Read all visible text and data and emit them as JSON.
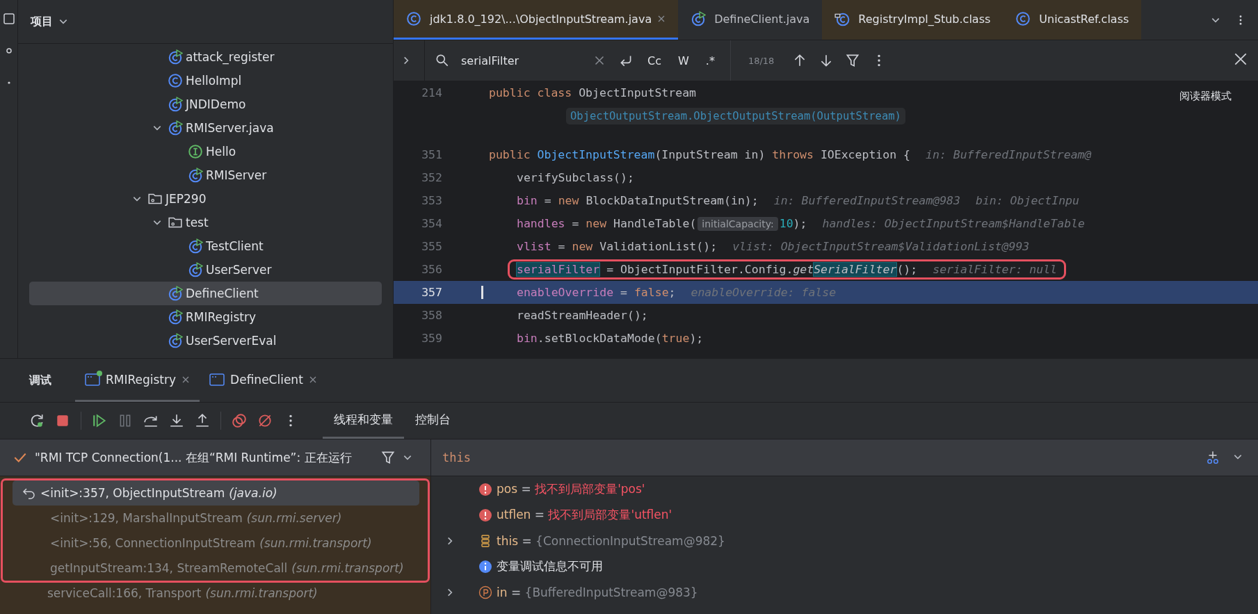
{
  "project": {
    "title": "项目",
    "tree": [
      {
        "children": [
          {
            "label": "attack_register",
            "kind": "class-run",
            "selected": false
          },
          {
            "label": "HelloImpl",
            "kind": "class",
            "selected": false
          },
          {
            "label": "JNDIDemo",
            "kind": "class-run",
            "selected": false
          },
          {
            "label": "RMIServer.java",
            "kind": "class-run",
            "selected": false,
            "expanded": true,
            "children": [
              {
                "label": "Hello",
                "kind": "interface",
                "selected": false
              },
              {
                "label": "RMIServer",
                "kind": "class-run",
                "selected": false
              }
            ]
          }
        ]
      },
      {
        "label": "JEP290",
        "kind": "folder",
        "selected": false,
        "expanded": true,
        "children": [
          {
            "label": "test",
            "kind": "folder",
            "selected": false,
            "expanded": true,
            "children": [
              {
                "label": "TestClient",
                "kind": "class-run",
                "selected": false
              },
              {
                "label": "UserServer",
                "kind": "class-run",
                "selected": false
              }
            ]
          },
          {
            "label": "DefineClient",
            "kind": "class-run",
            "selected": true
          },
          {
            "label": "RMIRegistry",
            "kind": "class-run",
            "selected": false
          },
          {
            "label": "UserServerEval",
            "kind": "class-run",
            "selected": false
          }
        ]
      }
    ]
  },
  "editor": {
    "tabs": [
      {
        "label": "jdk1.8.0_192\\...\\ObjectInputStream.java",
        "kind": "class",
        "selected": true,
        "closable": true
      },
      {
        "label": "DefineClient.java",
        "kind": "class-run",
        "selected": false,
        "closable": false
      },
      {
        "label": "RegistryImpl_Stub.class",
        "kind": "class-link",
        "selected": false,
        "closable": false
      },
      {
        "label": "UnicastRef.class",
        "kind": "class",
        "selected": false,
        "closable": false
      }
    ],
    "find": {
      "query": "serialFilter",
      "options": [
        "Cc",
        "W",
        ".*"
      ],
      "count": "18/18"
    },
    "reader_mode": "阅读器模式",
    "lines": [
      {
        "number": "214",
        "kind": "code",
        "indented": false,
        "tokens": [
          {
            "text": "public ",
            "kind": "kw"
          },
          {
            "text": "class ",
            "kind": "kw"
          },
          {
            "text": "ObjectInputStream",
            "kind": "plain"
          }
        ]
      },
      {
        "kind": "usage",
        "text": "ObjectOutputStream.ObjectOutputStream(OutputStream)"
      },
      {
        "number": "351",
        "kind": "code",
        "indented": false,
        "tokens": [
          {
            "text": "public ",
            "kind": "kw"
          },
          {
            "text": "ObjectInputStream",
            "kind": "fn"
          },
          {
            "text": "(InputStream in) ",
            "kind": "plain"
          },
          {
            "text": "throws ",
            "kind": "kw"
          },
          {
            "text": "IOException {",
            "kind": "plain"
          }
        ],
        "hints": [
          "in: BufferedInputStream@"
        ]
      },
      {
        "number": "352",
        "kind": "code",
        "indented": true,
        "tokens": [
          {
            "text": "verifySubclass();",
            "kind": "plain"
          }
        ]
      },
      {
        "number": "353",
        "kind": "code",
        "indented": true,
        "tokens": [
          {
            "text": "bin",
            "kind": "field"
          },
          {
            "text": " = ",
            "kind": "plain"
          },
          {
            "text": "new ",
            "kind": "kw"
          },
          {
            "text": "BlockDataInputStream(in);",
            "kind": "plain"
          }
        ],
        "hints": [
          "in: BufferedInputStream@983",
          "bin: ObjectInpu"
        ]
      },
      {
        "number": "354",
        "kind": "code",
        "indented": true,
        "tokens": [
          {
            "text": "handles",
            "kind": "field"
          },
          {
            "text": " = ",
            "kind": "plain"
          },
          {
            "text": "new ",
            "kind": "kw"
          },
          {
            "text": "HandleTable(",
            "kind": "plain"
          },
          {
            "text": "initialCapacity:",
            "kind": "param"
          },
          {
            "text": "10",
            "kind": "num"
          },
          {
            "text": ");",
            "kind": "plain"
          }
        ],
        "hints": [
          "handles: ObjectInputStream$HandleTable"
        ]
      },
      {
        "number": "355",
        "kind": "code",
        "indented": true,
        "tokens": [
          {
            "text": "vlist",
            "kind": "field"
          },
          {
            "text": " = ",
            "kind": "plain"
          },
          {
            "text": "new ",
            "kind": "kw"
          },
          {
            "text": "ValidationList();",
            "kind": "plain"
          }
        ],
        "hints": [
          "vlist: ObjectInputStream$ValidationList@993"
        ]
      },
      {
        "number": "356",
        "kind": "code",
        "indented": true,
        "boxed": true,
        "tokens": [
          {
            "text": "serialFilter",
            "kind": "field-match"
          },
          {
            "text": " = ObjectInputFilter.Config.",
            "kind": "plain"
          },
          {
            "text": "get",
            "kind": "static"
          },
          {
            "text": "SerialFilter",
            "kind": "static-match"
          },
          {
            "text": "();",
            "kind": "plain"
          }
        ],
        "hints": [
          "serialFilter: null"
        ]
      },
      {
        "number": "357",
        "kind": "code",
        "indented": true,
        "current": true,
        "tokens": [
          {
            "text": "enableOverride",
            "kind": "field"
          },
          {
            "text": " = ",
            "kind": "plain"
          },
          {
            "text": "false",
            "kind": "kw"
          },
          {
            "text": ";",
            "kind": "plain"
          }
        ],
        "hints": [
          "enableOverride: false"
        ]
      },
      {
        "number": "358",
        "kind": "code",
        "indented": true,
        "tokens": [
          {
            "text": "readStreamHeader();",
            "kind": "plain"
          }
        ]
      },
      {
        "number": "359",
        "kind": "code",
        "indented": true,
        "tokens": [
          {
            "text": "bin",
            "kind": "field"
          },
          {
            "text": ".setBlockDataMode(",
            "kind": "plain"
          },
          {
            "text": "true",
            "kind": "kw"
          },
          {
            "text": ");",
            "kind": "plain"
          }
        ]
      }
    ]
  },
  "debug": {
    "title": "调试",
    "sessions": [
      {
        "label": "RMIRegistry",
        "selected": true,
        "running": true
      },
      {
        "label": "DefineClient",
        "selected": false,
        "running": false
      }
    ],
    "view_tabs": [
      {
        "label": "线程和变量",
        "selected": true
      },
      {
        "label": "控制台",
        "selected": false
      }
    ],
    "thread": "\"RMI TCP Connection(1... 在组“RMI Runtime”: 正在运行",
    "frames": [
      {
        "method": "<init>:357, ObjectInputStream",
        "package": "(java.io)",
        "selected": true,
        "boxed": true
      },
      {
        "method": "<init>:129, MarshalInputStream",
        "package": "(sun.rmi.server)",
        "selected": false,
        "boxed": true
      },
      {
        "method": "<init>:56, ConnectionInputStream",
        "package": "(sun.rmi.transport)",
        "selected": false,
        "boxed": true
      },
      {
        "method": "getInputStream:134, StreamRemoteCall",
        "package": "(sun.rmi.transport)",
        "selected": false,
        "boxed": true
      },
      {
        "method": "serviceCall:166, Transport",
        "package": "(sun.rmi.transport)",
        "selected": false,
        "boxed": false
      }
    ],
    "expression": "this",
    "variables": [
      {
        "kind": "error",
        "name": "pos",
        "operator": "=",
        "value": "找不到局部变量'pos'",
        "expandable": false
      },
      {
        "kind": "error",
        "name": "utflen",
        "operator": "=",
        "value": "找不到局部变量'utflen'",
        "expandable": false
      },
      {
        "kind": "object",
        "name": "this",
        "operator": "=",
        "value": "{ConnectionInputStream@982}",
        "expandable": true
      },
      {
        "kind": "info",
        "text": "变量调试信息不可用",
        "expandable": false
      },
      {
        "kind": "param",
        "name": "in",
        "operator": "=",
        "value": "{BufferedInputStream@983}",
        "expandable": true
      }
    ]
  }
}
